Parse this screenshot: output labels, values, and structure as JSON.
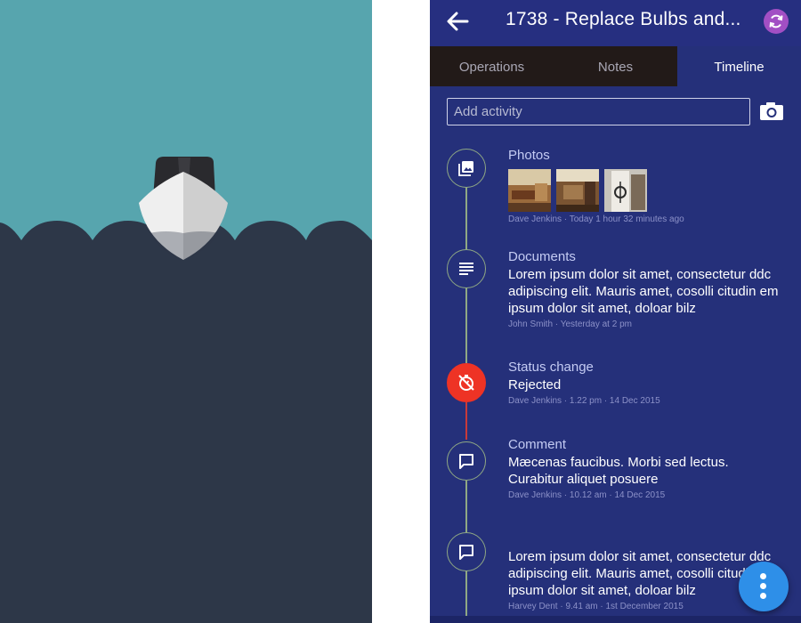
{
  "header": {
    "title": "1738 - Replace Bulbs and...",
    "back_icon": "arrow-left-icon",
    "sync_icon": "sync-icon"
  },
  "tabs": [
    {
      "label": "Operations",
      "active": false
    },
    {
      "label": "Notes",
      "active": false
    },
    {
      "label": "Timeline",
      "active": true
    }
  ],
  "add_activity": {
    "placeholder": "Add activity",
    "camera_icon": "camera-icon"
  },
  "timeline": [
    {
      "type": "photos",
      "icon": "image-icon",
      "title": "Photos",
      "body": "",
      "meta": "Dave Jenkins  ·  Today 1 hour 32 minutes ago",
      "photo_count": 3
    },
    {
      "type": "documents",
      "icon": "document-lines-icon",
      "title": "Documents",
      "body": "Lorem ipsum dolor sit amet, consectetur ddc adipiscing elit. Mauris amet, cosolli citudin em ipsum dolor sit amet, doloar bilz",
      "meta": "John Smith  ·  Yesterday at 2 pm"
    },
    {
      "type": "status",
      "icon": "timer-off-icon",
      "title": "Status change",
      "body": "Rejected",
      "meta": "Dave Jenkins  ·  1.22 pm  ·  14 Dec 2015"
    },
    {
      "type": "comment",
      "icon": "comment-icon",
      "title": "Comment",
      "body": "Mæcenas faucibus. Morbi sed lectus. Curabitur aliquet posuere",
      "meta": "Dave Jenkins  ·  10.12 am  ·  14 Dec 2015"
    },
    {
      "type": "comment",
      "icon": "comment-icon",
      "title": "",
      "body": "Lorem ipsum dolor sit amet, consectetur ddc adipiscing elit. Mauris amet, cosolli citudin em ipsum dolor sit amet, doloar bilz",
      "meta": "Harvey Dent  ·  9.41 am  ·  1st December 2015"
    }
  ],
  "fab": {
    "icon": "more-vertical-icon"
  },
  "colors": {
    "screen_bg": "#25307a",
    "tab_bar": "#221a18",
    "status_rejected": "#ee3325",
    "fab": "#2e8fe8",
    "sync_button": "#a24fc4",
    "sea_top": "#57a5ae",
    "sea_deep": "#2d3748"
  }
}
